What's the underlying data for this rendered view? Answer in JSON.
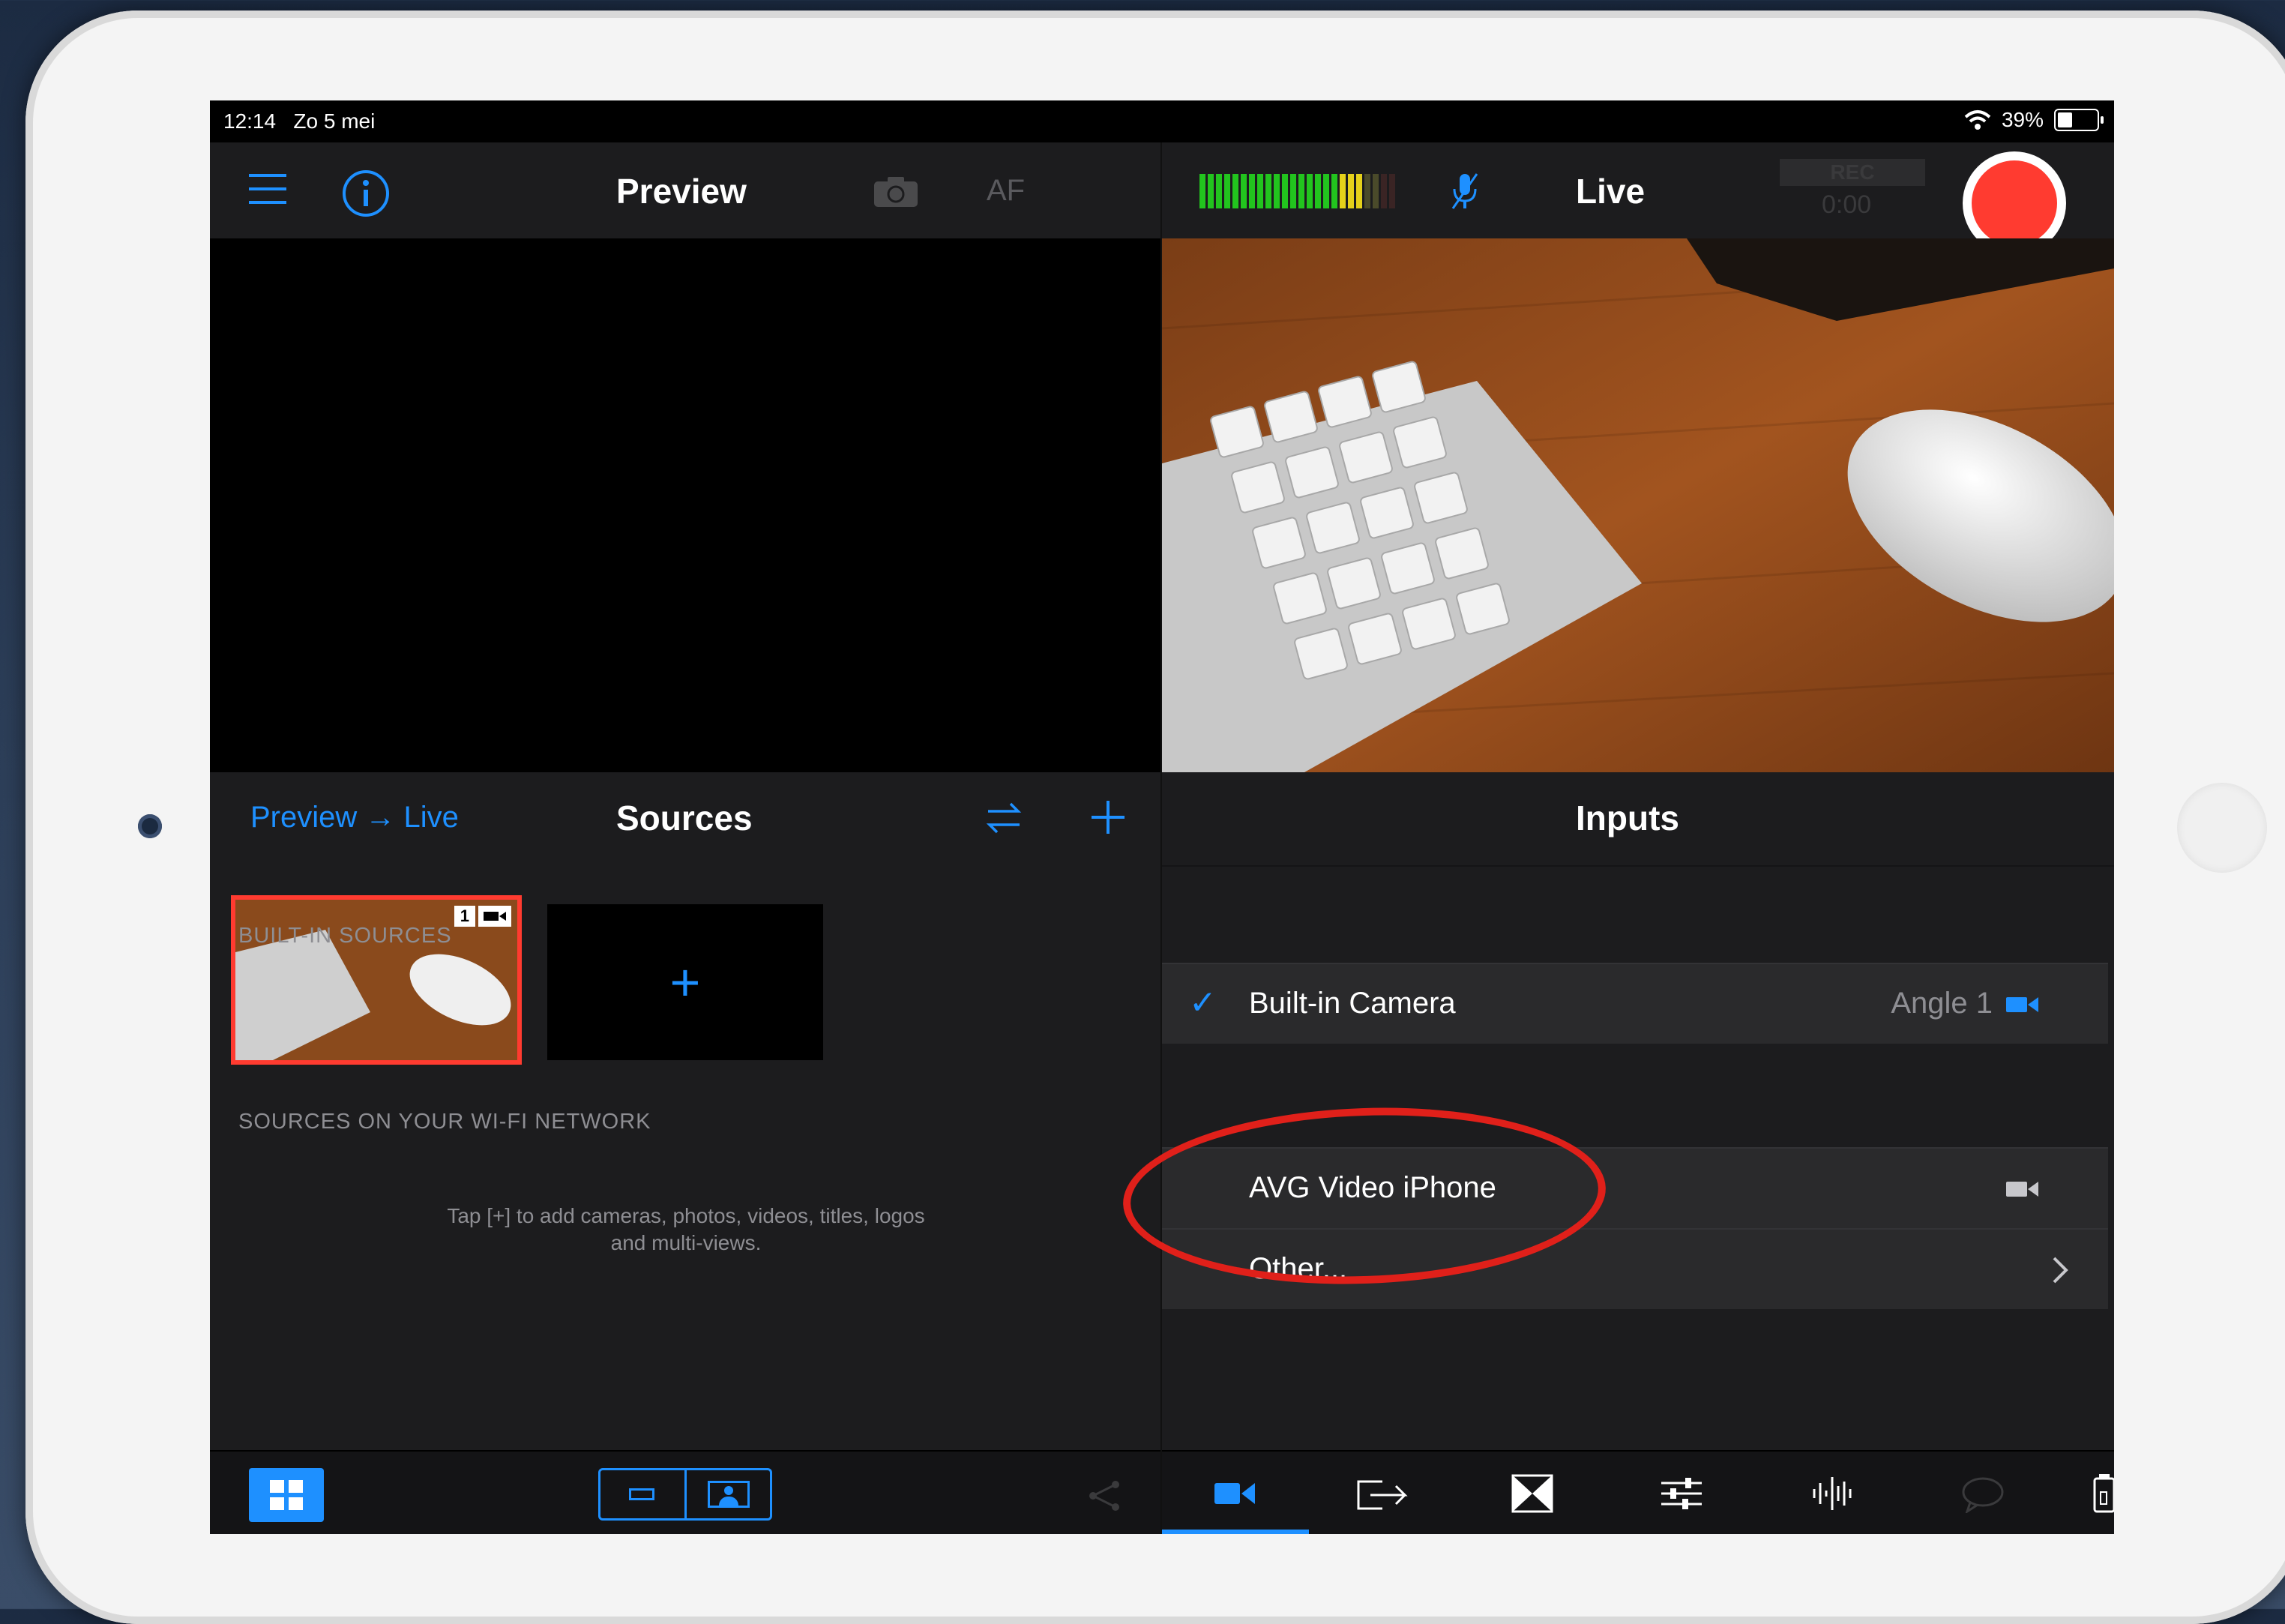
{
  "status_bar": {
    "time_date": "12:14   Zo 5 mei",
    "battery_text": "39%",
    "battery_level": 0.39
  },
  "preview_bar": {
    "title": "Preview",
    "af_label": "AF"
  },
  "live_bar": {
    "title": "Live",
    "rec_label": "REC",
    "rec_time": "0:00"
  },
  "sources_panel": {
    "preview_live_label": "Preview → Live",
    "title": "Sources",
    "selected_source_number": "1",
    "add_symbol": "+",
    "hint": "Tap [+] to add cameras, photos, videos, titles, logos and multi-views."
  },
  "inputs_panel": {
    "title": "Inputs",
    "builtin_section": "BUILT-IN SOURCES",
    "builtin_camera": {
      "check": "✓",
      "label": "Built-in Camera",
      "detail": "Angle 1"
    },
    "network_section": "SOURCES ON YOUR WI-FI NETWORK",
    "network_sources": [
      {
        "label": "AVG Video iPhone"
      },
      {
        "label": "Other..."
      }
    ]
  },
  "colors": {
    "accent": "#1e90ff",
    "record": "#ff3b30",
    "annotation": "#e0201a"
  },
  "icons": {
    "menu": "hamburger-icon",
    "info": "info-icon",
    "camera_flip": "camera-flip-icon",
    "mic": "microphone-icon",
    "swap": "swap-icon",
    "add": "plus-icon"
  }
}
